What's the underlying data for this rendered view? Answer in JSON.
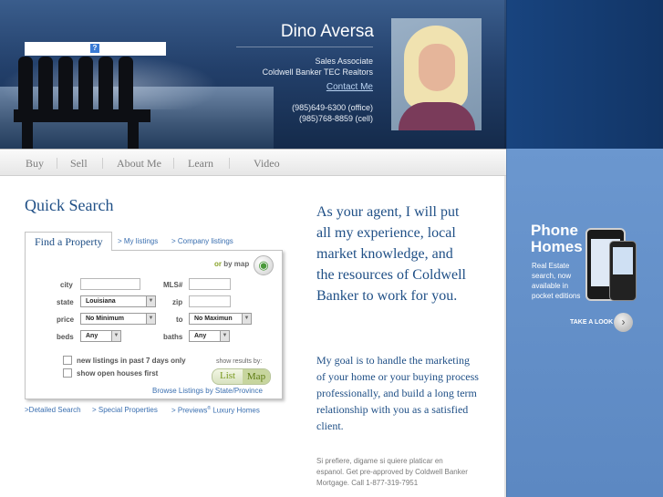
{
  "agent": {
    "name": "Dino Aversa",
    "title": "Sales Associate",
    "company": "Coldwell Banker TEC Realtors",
    "contact_link": "Contact Me",
    "phone_office": "(985)649-6300 (office)",
    "phone_cell": "(985)768-8859 (cell)"
  },
  "nav": {
    "items": [
      "Buy",
      "Sell",
      "About Me",
      "Learn",
      "Video"
    ]
  },
  "quick_search": {
    "title": "Quick Search",
    "tab_find": "Find a Property",
    "tab_my_listings": "> My listings",
    "tab_company_listings": "> Company listings",
    "or_text": "or",
    "by_map_text": "by map",
    "labels": {
      "city": "city",
      "mls": "MLS#",
      "state": "state",
      "zip": "zip",
      "price": "price",
      "to": "to",
      "beds": "beds",
      "baths": "baths"
    },
    "state_value": "Louisiana",
    "price_min_value": "No Minimum",
    "price_max_value": "No Maximun",
    "beds_value": "Any",
    "baths_value": "Any",
    "new_listings_label": "new listings in past 7 days only",
    "open_houses_label": "show open houses first",
    "show_results_label": "show results by:",
    "list_label": "List",
    "map_label": "Map",
    "browse_link": "Browse Listings by State/Province"
  },
  "bottom_links": {
    "detailed": ">Detailed Search",
    "special": "> Special Properties",
    "previews_a": "> Previews",
    "previews_reg": "®",
    "previews_b": " Luxury Homes"
  },
  "main_text": "As your agent, I will put all my experience, local market knowledge, and the resources of Coldwell Banker to work for you.",
  "goal_text": "My goal is to handle the marketing of your home or your buying process professionally, and build a long term relationship with you as a satisfied client.",
  "spanish_text": "Si prefiere, digame si quiere platicar en espanol. Get pre-approved by Coldwell Banker Mortgage. Call 1-877-319-7951",
  "promo": {
    "title_line1": "Phone",
    "title_line2": "Homes",
    "text": "Real Estate search, now available in pocket editions",
    "cta": "TAKE A LOOK"
  },
  "icons": {
    "help": "help-icon",
    "globe": "globe-icon",
    "arrow": "chevron-right-icon"
  }
}
